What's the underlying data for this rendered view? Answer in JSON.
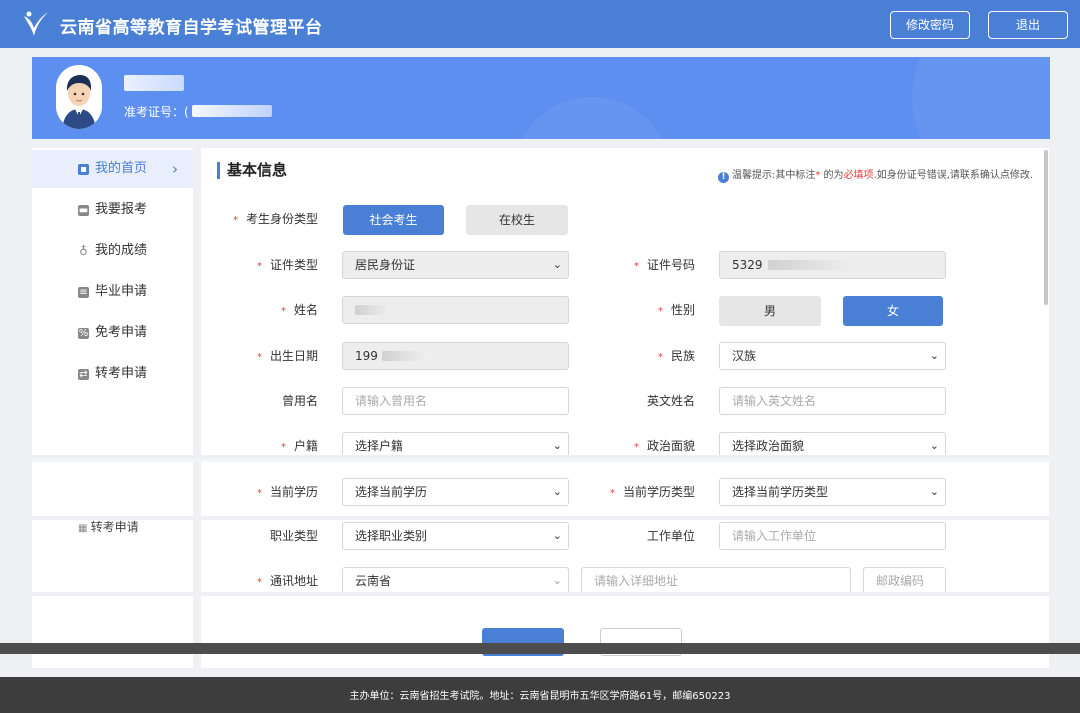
{
  "header": {
    "title": "云南省高等教育自学考试管理平台",
    "change_password": "修改密码",
    "logout": "退出"
  },
  "profile": {
    "exam_no_label": "准考证号：("
  },
  "sidebar": {
    "items": [
      {
        "label": "我的首页",
        "icon": "home-icon",
        "active": true
      },
      {
        "label": "我要报考",
        "icon": "register-icon"
      },
      {
        "label": "我的成绩",
        "icon": "score-icon"
      },
      {
        "label": "毕业申请",
        "icon": "graduation-icon"
      },
      {
        "label": "免考申请",
        "icon": "exemption-icon"
      },
      {
        "label": "转考申请",
        "icon": "transfer-icon"
      }
    ],
    "ghost_item": "转考申请"
  },
  "main": {
    "section_title": "基本信息",
    "tip": {
      "prefix": "温馨提示:其中标注",
      "star": "*",
      "middle": " 的为",
      "required": "必填项",
      "suffix": ".如身份证号错误,请联系确认点修改."
    },
    "identity_type": {
      "label": "考生身份类型",
      "options": [
        "社会考生",
        "在校生"
      ],
      "selected": "社会考生"
    },
    "id_type": {
      "label": "证件类型",
      "value": "居民身份证"
    },
    "id_number": {
      "label": "证件号码",
      "value": "5329"
    },
    "name": {
      "label": "姓名"
    },
    "gender": {
      "label": "性别",
      "options": [
        "男",
        "女"
      ],
      "selected": "女"
    },
    "birthdate": {
      "label": "出生日期",
      "value": "199"
    },
    "ethnicity": {
      "label": "民族",
      "value": "汉族"
    },
    "former_name": {
      "label": "曾用名",
      "placeholder": "请输入曾用名"
    },
    "english_name": {
      "label": "英文姓名",
      "placeholder": "请输入英文姓名"
    },
    "household": {
      "label": "户籍",
      "placeholder": "选择户籍"
    },
    "political": {
      "label": "政治面貌",
      "placeholder": "选择政治面貌"
    },
    "education": {
      "label": "当前学历",
      "placeholder": "选择当前学历"
    },
    "education_type": {
      "label": "当前学历类型",
      "placeholder": "选择当前学历类型"
    },
    "occupation": {
      "label": "职业类型",
      "placeholder": "选择职业类别"
    },
    "employer": {
      "label": "工作单位",
      "placeholder": "请输入工作单位"
    },
    "address": {
      "label": "通讯地址",
      "province": "云南省",
      "detail_placeholder": "请输入详细地址",
      "postcode_placeholder": "邮政编码"
    }
  },
  "footer": {
    "text": "主办单位：云南省招生考试院。地址：云南省昆明市五华区学府路61号，邮编650223"
  },
  "colors": {
    "primary": "#4a7fd6",
    "banner": "#5c8ff0",
    "required": "#e43d3d",
    "footer_bg": "#3d3d3d"
  }
}
